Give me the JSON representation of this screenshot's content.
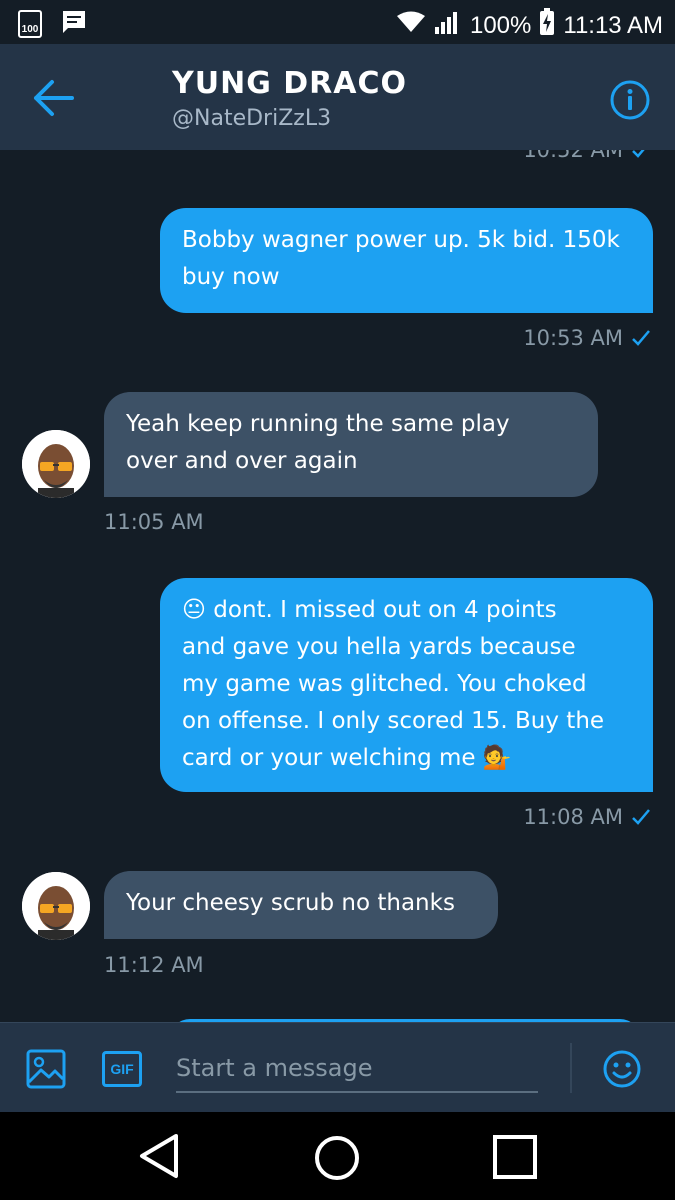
{
  "status_bar": {
    "left_badge": "100",
    "battery": "100%",
    "time": "11:13 AM"
  },
  "header": {
    "name": "YUNG DRACO",
    "handle": "@NateDriZzL3"
  },
  "messages": [
    {
      "type": "sent",
      "time": "10:52 AM",
      "partial": true
    },
    {
      "type": "sent",
      "lines": [
        "Bobby wagner power up. 5k bid. 150k",
        "buy now"
      ],
      "time": "10:53 AM"
    },
    {
      "type": "received",
      "lines": [
        "Yeah keep running the same play",
        "over and over again"
      ],
      "time": "11:05 AM"
    },
    {
      "type": "sent",
      "lines": [
        "😐 dont. I missed out on 4 points",
        "and gave you hella yards because",
        "my game was glitched. You choked",
        "on offense. I only scored 15. Buy the",
        "card or your welching me 💁"
      ],
      "time": "11:08 AM"
    },
    {
      "type": "received",
      "lines": [
        "Your cheesy scrub no thanks"
      ],
      "time": "11:12 AM"
    }
  ],
  "composer": {
    "placeholder": "Start a message",
    "gif_label": "GIF"
  },
  "colors": {
    "background": "#141d26",
    "header": "#243447",
    "sent_bubble": "#1da1f2",
    "received_bubble": "#3d5166",
    "accent": "#1da1f2",
    "timestamp": "#8899a6"
  }
}
